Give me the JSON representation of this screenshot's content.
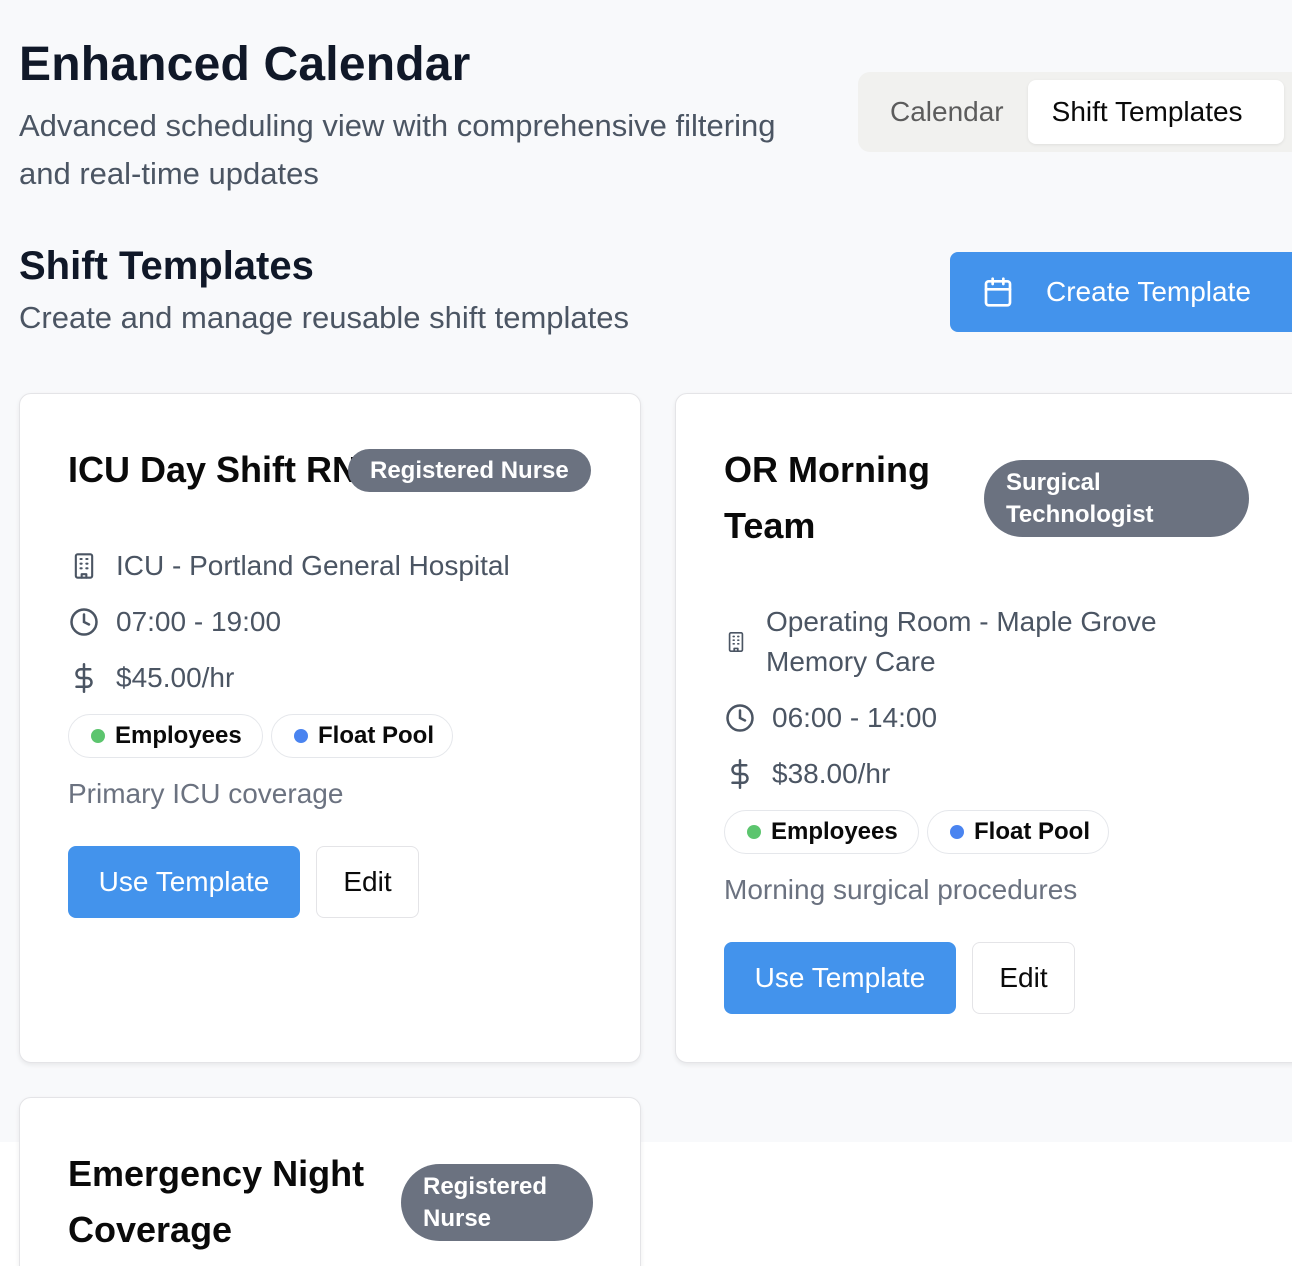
{
  "header": {
    "title": "Enhanced Calendar",
    "subtitle": "Advanced scheduling view with comprehensive filtering and real-time updates"
  },
  "view_tabs": [
    {
      "label": "Calendar",
      "active": false
    },
    {
      "label": "Shift Templates",
      "active": true
    }
  ],
  "section": {
    "title": "Shift Templates",
    "subtitle": "Create and manage reusable shift templates",
    "create_button": "Create Template",
    "create_icon": "calendar-icon"
  },
  "colors": {
    "accent": "#4393ec",
    "badge": "#6b7280",
    "employees_dot": "#5cc56e",
    "float_pool_dot": "#4a84f0"
  },
  "templates": [
    {
      "title": "ICU Day Shift RN",
      "role": "Registered Nurse",
      "location": "ICU - Portland General Hospital",
      "time": "07:00 - 19:00",
      "rate": "$45.00/hr",
      "pools": [
        "Employees",
        "Float Pool"
      ],
      "note": "Primary ICU coverage",
      "use_label": "Use Template",
      "edit_label": "Edit"
    },
    {
      "title": "OR Morning Team",
      "title_lines": [
        "OR Morning",
        "Team"
      ],
      "role": "Surgical Technologist",
      "role_lines": [
        "Surgical",
        "Technologist"
      ],
      "location": "Operating Room - Maple Grove Memory Care",
      "location_lines": [
        "Operating Room - Maple Grove",
        "Memory Care"
      ],
      "time": "06:00 - 14:00",
      "rate": "$38.00/hr",
      "pools": [
        "Employees",
        "Float Pool"
      ],
      "note": "Morning surgical procedures",
      "use_label": "Use Template",
      "edit_label": "Edit"
    },
    {
      "title": "Emergency Night Coverage",
      "title_lines": [
        "Emergency Night",
        "Coverage"
      ],
      "role": "Registered Nurse",
      "role_lines": [
        "Registered",
        "Nurse"
      ]
    }
  ]
}
